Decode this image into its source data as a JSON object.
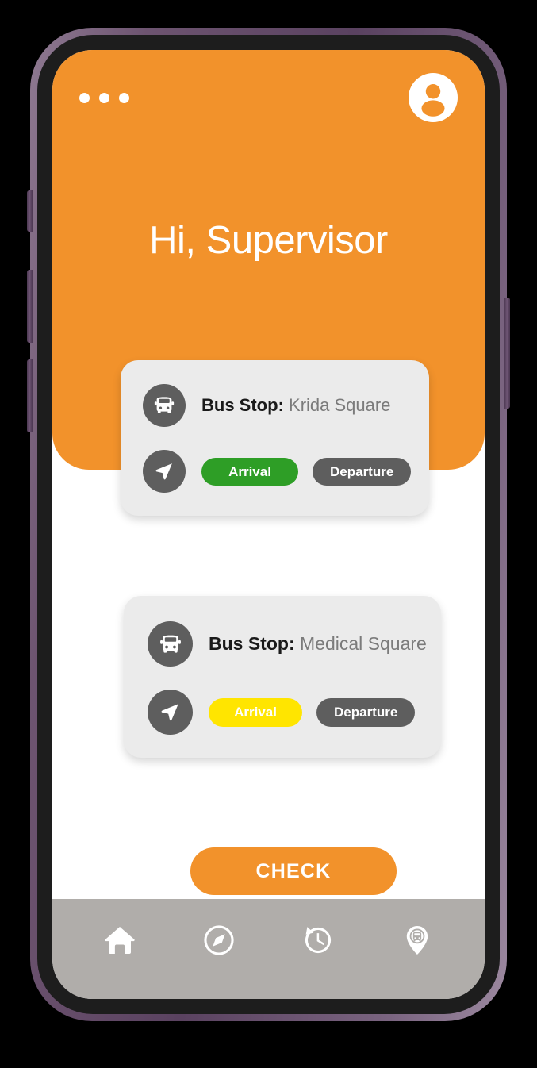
{
  "app": {
    "header": {
      "greeting": "Hi, Supervisor",
      "menu_icon": "more-horizontal-icon",
      "avatar_icon": "account-circle-icon",
      "background_color": "#F2922B"
    },
    "stops": [
      {
        "bus_icon": "bus-icon",
        "nav_icon": "navigation-arrow-icon",
        "label": "Bus Stop:",
        "name": "Krida Square",
        "arrival_label": "Arrival",
        "arrival_color": "#2E9E26",
        "departure_label": "Departure",
        "departure_color": "#5E5E5E"
      },
      {
        "bus_icon": "bus-icon",
        "nav_icon": "navigation-arrow-icon",
        "label": "Bus Stop:",
        "name": "Medical Square",
        "arrival_label": "Arrival",
        "arrival_color": "#FFE500",
        "departure_label": "Departure",
        "departure_color": "#5E5E5E"
      }
    ],
    "check_button": {
      "label": "CHECK",
      "color": "#F2922B"
    },
    "bottom_nav": {
      "background_color": "#B0ADAA",
      "items": [
        {
          "icon": "home-icon",
          "name": "home"
        },
        {
          "icon": "compass-icon",
          "name": "explore"
        },
        {
          "icon": "history-clock-icon",
          "name": "history"
        },
        {
          "icon": "bus-location-pin-icon",
          "name": "bus-tracker"
        }
      ]
    }
  },
  "device": {
    "frame_color": "#6D5470",
    "bezel_color": "#1D1D1D",
    "buttons": [
      "silent-switch",
      "volume-up",
      "volume-down",
      "power"
    ]
  }
}
